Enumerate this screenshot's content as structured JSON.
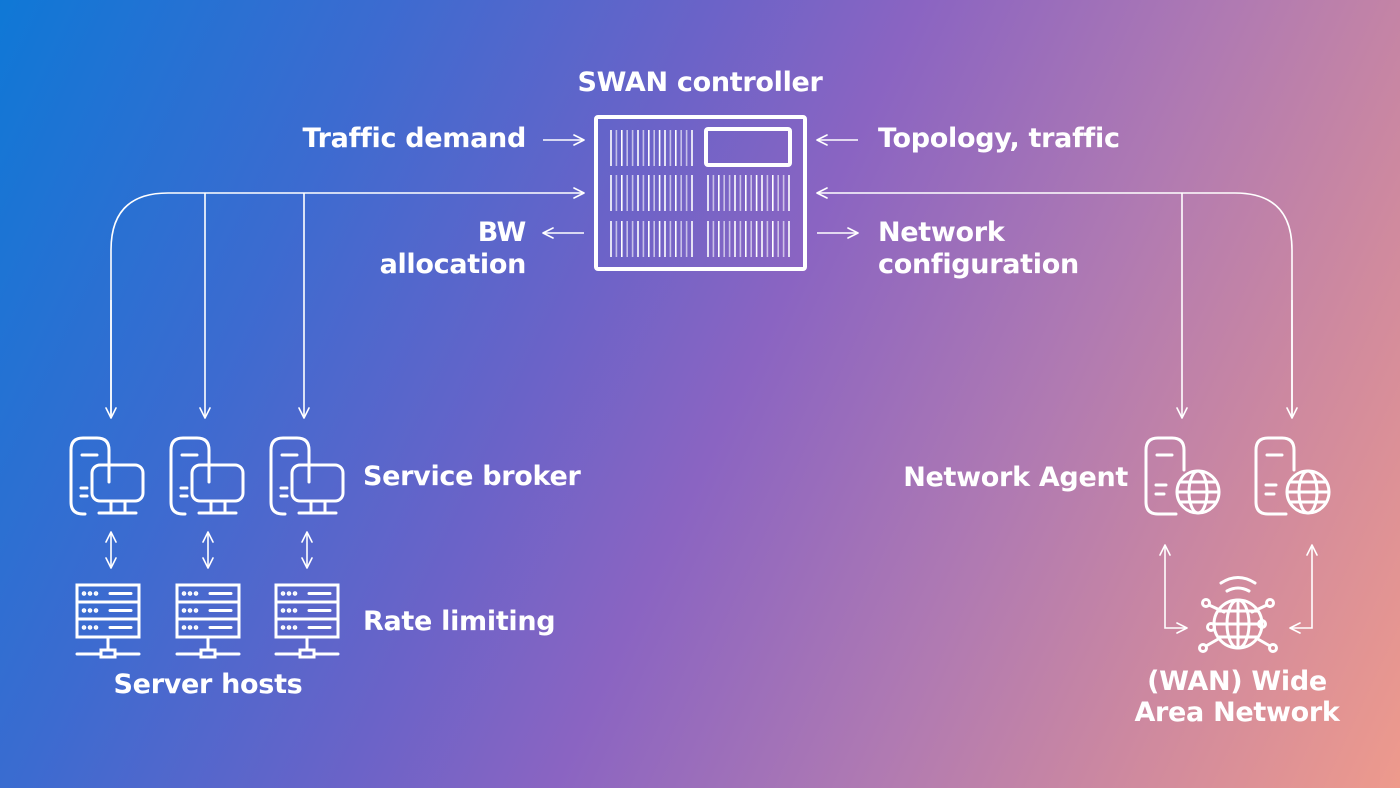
{
  "title": "SWAN controller",
  "labels": {
    "controller": "SWAN controller",
    "traffic_demand": "Traffic demand",
    "bw_allocation_line1": "BW",
    "bw_allocation_line2": "allocation",
    "topology_traffic": "Topology, traffic",
    "network_config_line1": "Network",
    "network_config_line2": "configuration",
    "service_broker": "Service broker",
    "rate_limiting": "Rate limiting",
    "server_hosts": "Server hosts",
    "network_agent": "Network Agent",
    "wan_line1": "(WAN) Wide",
    "wan_line2": "Area Network"
  },
  "nodes": {
    "service_broker_count": 3,
    "server_host_count": 3,
    "network_agent_count": 2
  },
  "colors": {
    "stroke": "#ffffff",
    "gradient_start": "#0f78d6",
    "gradient_mid": "#8a64c2",
    "gradient_end": "#ee9a8c"
  }
}
